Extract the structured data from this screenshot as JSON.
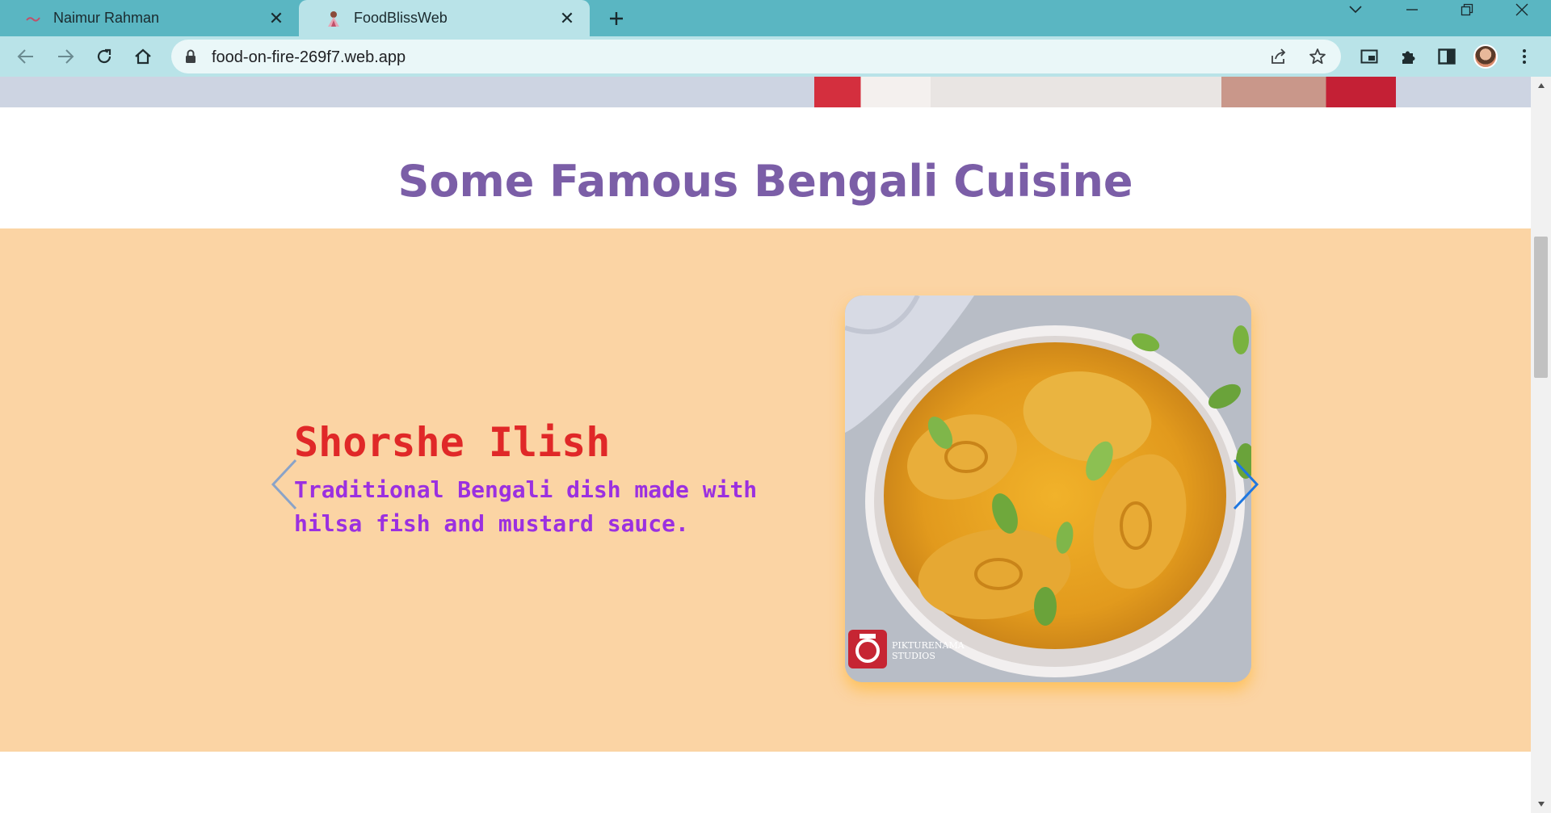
{
  "browser": {
    "tabs": [
      {
        "title": "Naimur Rahman",
        "active": false,
        "icon": "profile-favicon-icon"
      },
      {
        "title": "FoodBlissWeb",
        "active": true,
        "icon": "foodbliss-favicon-icon"
      }
    ],
    "url": "food-on-fire-269f7.web.app",
    "accent": "#5ab6c2",
    "toolbar_color": "#b9e3e8"
  },
  "page": {
    "section_title": "Some Famous Bengali Cuisine",
    "carousel": {
      "dish_name": "Shorshe Ilish",
      "dish_description": "Traditional Bengali dish made with hilsa fish and mustard sauce.",
      "image_watermark_line1": "PIKTURENAMA",
      "image_watermark_line2": "STUDIOS",
      "background": "#fbd4a4"
    }
  }
}
